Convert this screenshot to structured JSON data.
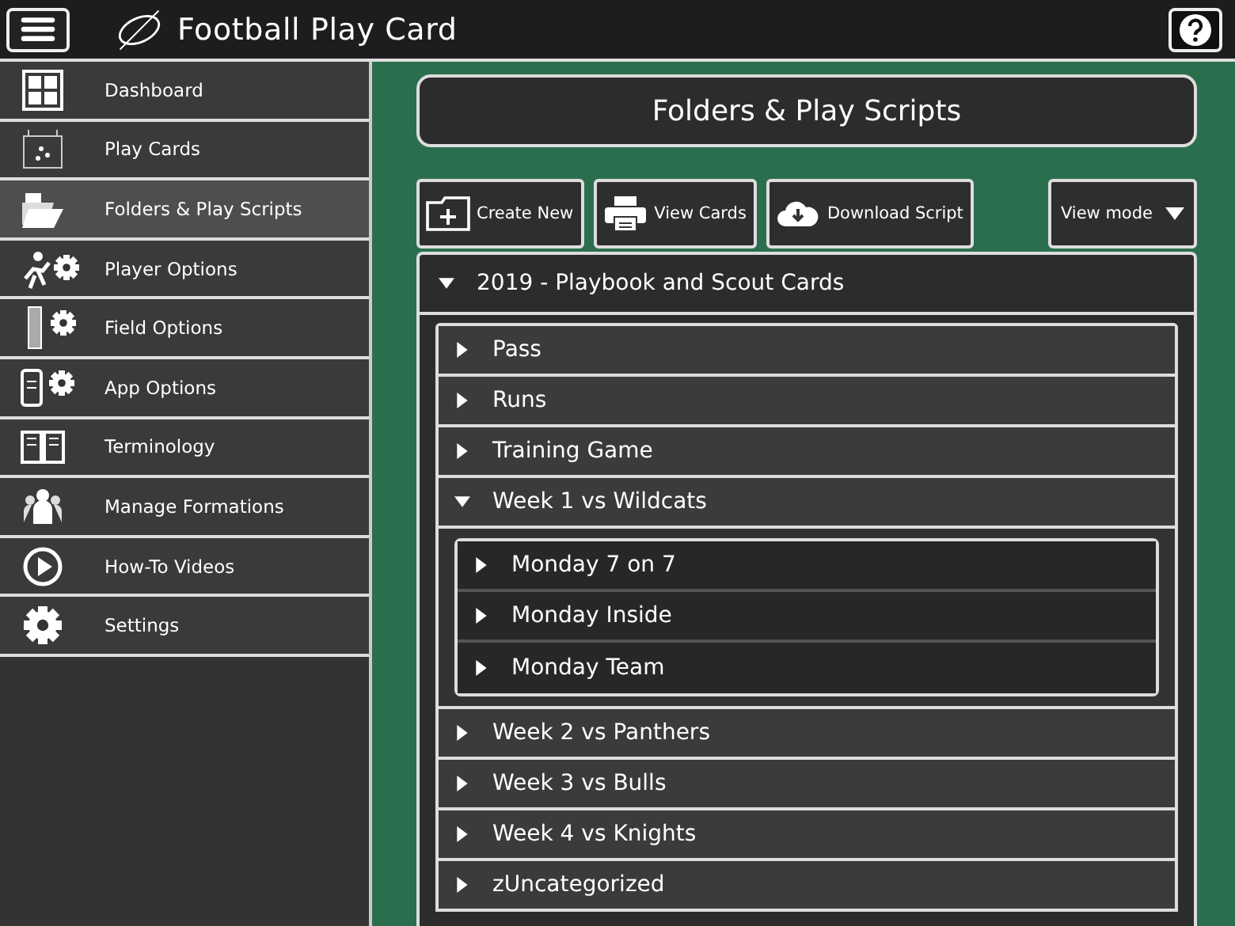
{
  "header": {
    "title": "Football Play Card"
  },
  "sidebar": {
    "items": [
      {
        "label": "Dashboard",
        "selected": false
      },
      {
        "label": "Play Cards",
        "selected": false
      },
      {
        "label": "Folders & Play Scripts",
        "selected": true
      },
      {
        "label": "Player Options",
        "selected": false
      },
      {
        "label": "Field Options",
        "selected": false
      },
      {
        "label": "App Options",
        "selected": false
      },
      {
        "label": "Terminology",
        "selected": false
      },
      {
        "label": "Manage Formations",
        "selected": false
      },
      {
        "label": "How-To Videos",
        "selected": false
      },
      {
        "label": "Settings",
        "selected": false
      }
    ]
  },
  "page_title": "Folders & Play Scripts",
  "toolbar": {
    "buttons": [
      {
        "label": "Create New"
      },
      {
        "label": "View Cards"
      },
      {
        "label": "Download Script"
      }
    ],
    "view_mode": "View mode"
  },
  "folders": [
    {
      "label": "2019 - Playbook and Scout Cards",
      "expanded": true,
      "children": [
        {
          "label": "Pass",
          "expanded": false
        },
        {
          "label": "Runs",
          "expanded": false
        },
        {
          "label": "Training Game",
          "expanded": false
        },
        {
          "label": "Week 1 vs Wildcats",
          "expanded": true,
          "children": [
            {
              "label": "Monday 7 on 7",
              "expanded": false
            },
            {
              "label": "Monday Inside",
              "expanded": false
            },
            {
              "label": "Monday Team",
              "expanded": false
            }
          ]
        },
        {
          "label": "Week 2 vs Panthers",
          "expanded": false
        },
        {
          "label": "Week 3 vs Bulls",
          "expanded": false
        },
        {
          "label": "Week 4 vs Knights",
          "expanded": false
        },
        {
          "label": "zUncategorized",
          "expanded": false
        }
      ]
    }
  ]
}
